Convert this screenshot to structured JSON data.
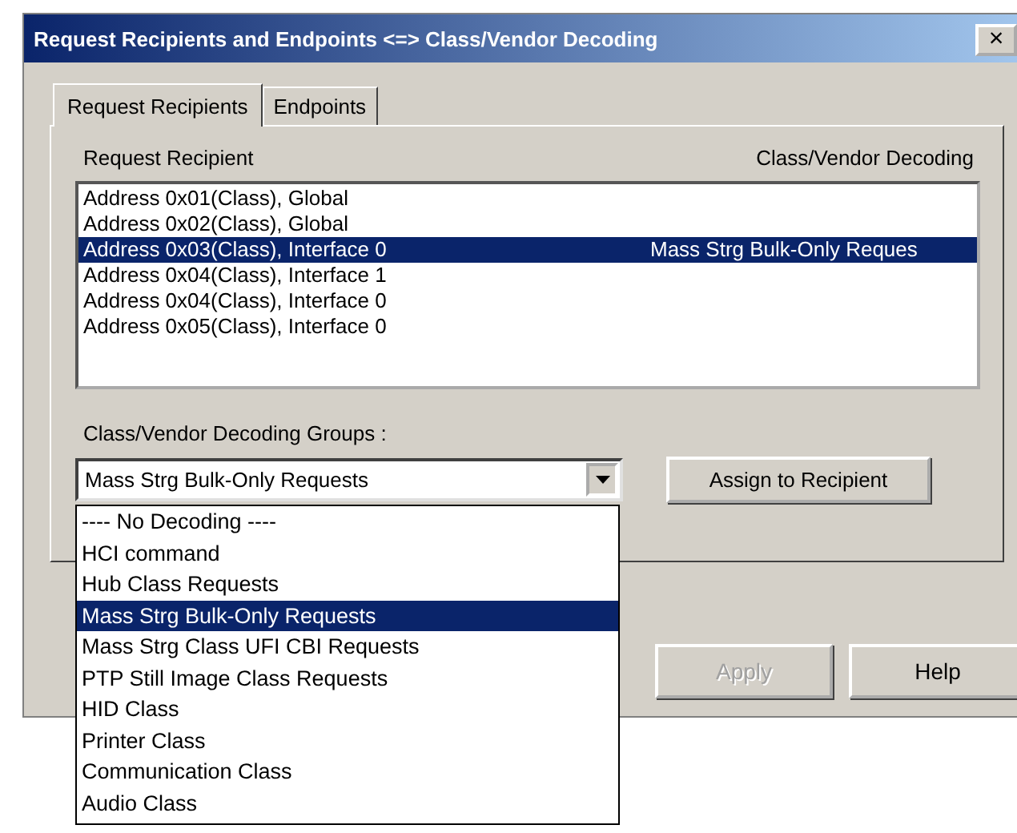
{
  "window": {
    "title": "Request Recipients and Endpoints <=> Class/Vendor Decoding",
    "close": "×"
  },
  "tabs": [
    {
      "label": "Request Recipients",
      "selected": true
    },
    {
      "label": "Endpoints",
      "selected": false
    }
  ],
  "recipients": {
    "columns": [
      "Request Recipient",
      "Class/Vendor Decoding"
    ],
    "rows": [
      {
        "recipient": "Address 0x01(Class), Global",
        "decoding": "",
        "selected": false
      },
      {
        "recipient": "Address 0x02(Class), Global",
        "decoding": "",
        "selected": false
      },
      {
        "recipient": "Address 0x03(Class), Interface 0",
        "decoding": "Mass Strg Bulk-Only Reques",
        "selected": true
      },
      {
        "recipient": "Address 0x04(Class), Interface 1",
        "decoding": "",
        "selected": false
      },
      {
        "recipient": "Address 0x04(Class), Interface 0",
        "decoding": "",
        "selected": false
      },
      {
        "recipient": "Address 0x05(Class), Interface 0",
        "decoding": "",
        "selected": false
      }
    ]
  },
  "groups": {
    "label": "Class/Vendor Decoding Groups :",
    "value": "Mass Strg Bulk-Only Requests",
    "expanded": true,
    "options": [
      {
        "label": "---- No Decoding ----",
        "selected": false
      },
      {
        "label": "HCI command",
        "selected": false
      },
      {
        "label": "Hub Class Requests",
        "selected": false
      },
      {
        "label": "Mass Strg Bulk-Only Requests",
        "selected": true
      },
      {
        "label": "Mass Strg Class UFI CBI Requests",
        "selected": false
      },
      {
        "label": "PTP Still Image Class Requests",
        "selected": false
      },
      {
        "label": "HID Class",
        "selected": false
      },
      {
        "label": "Printer Class",
        "selected": false
      },
      {
        "label": "Communication Class",
        "selected": false
      },
      {
        "label": "Audio Class",
        "selected": false
      }
    ]
  },
  "assign_button": "Assign to Recipient",
  "buttons": [
    {
      "label": "Apply",
      "disabled": true
    },
    {
      "label": "Help",
      "disabled": false
    }
  ]
}
